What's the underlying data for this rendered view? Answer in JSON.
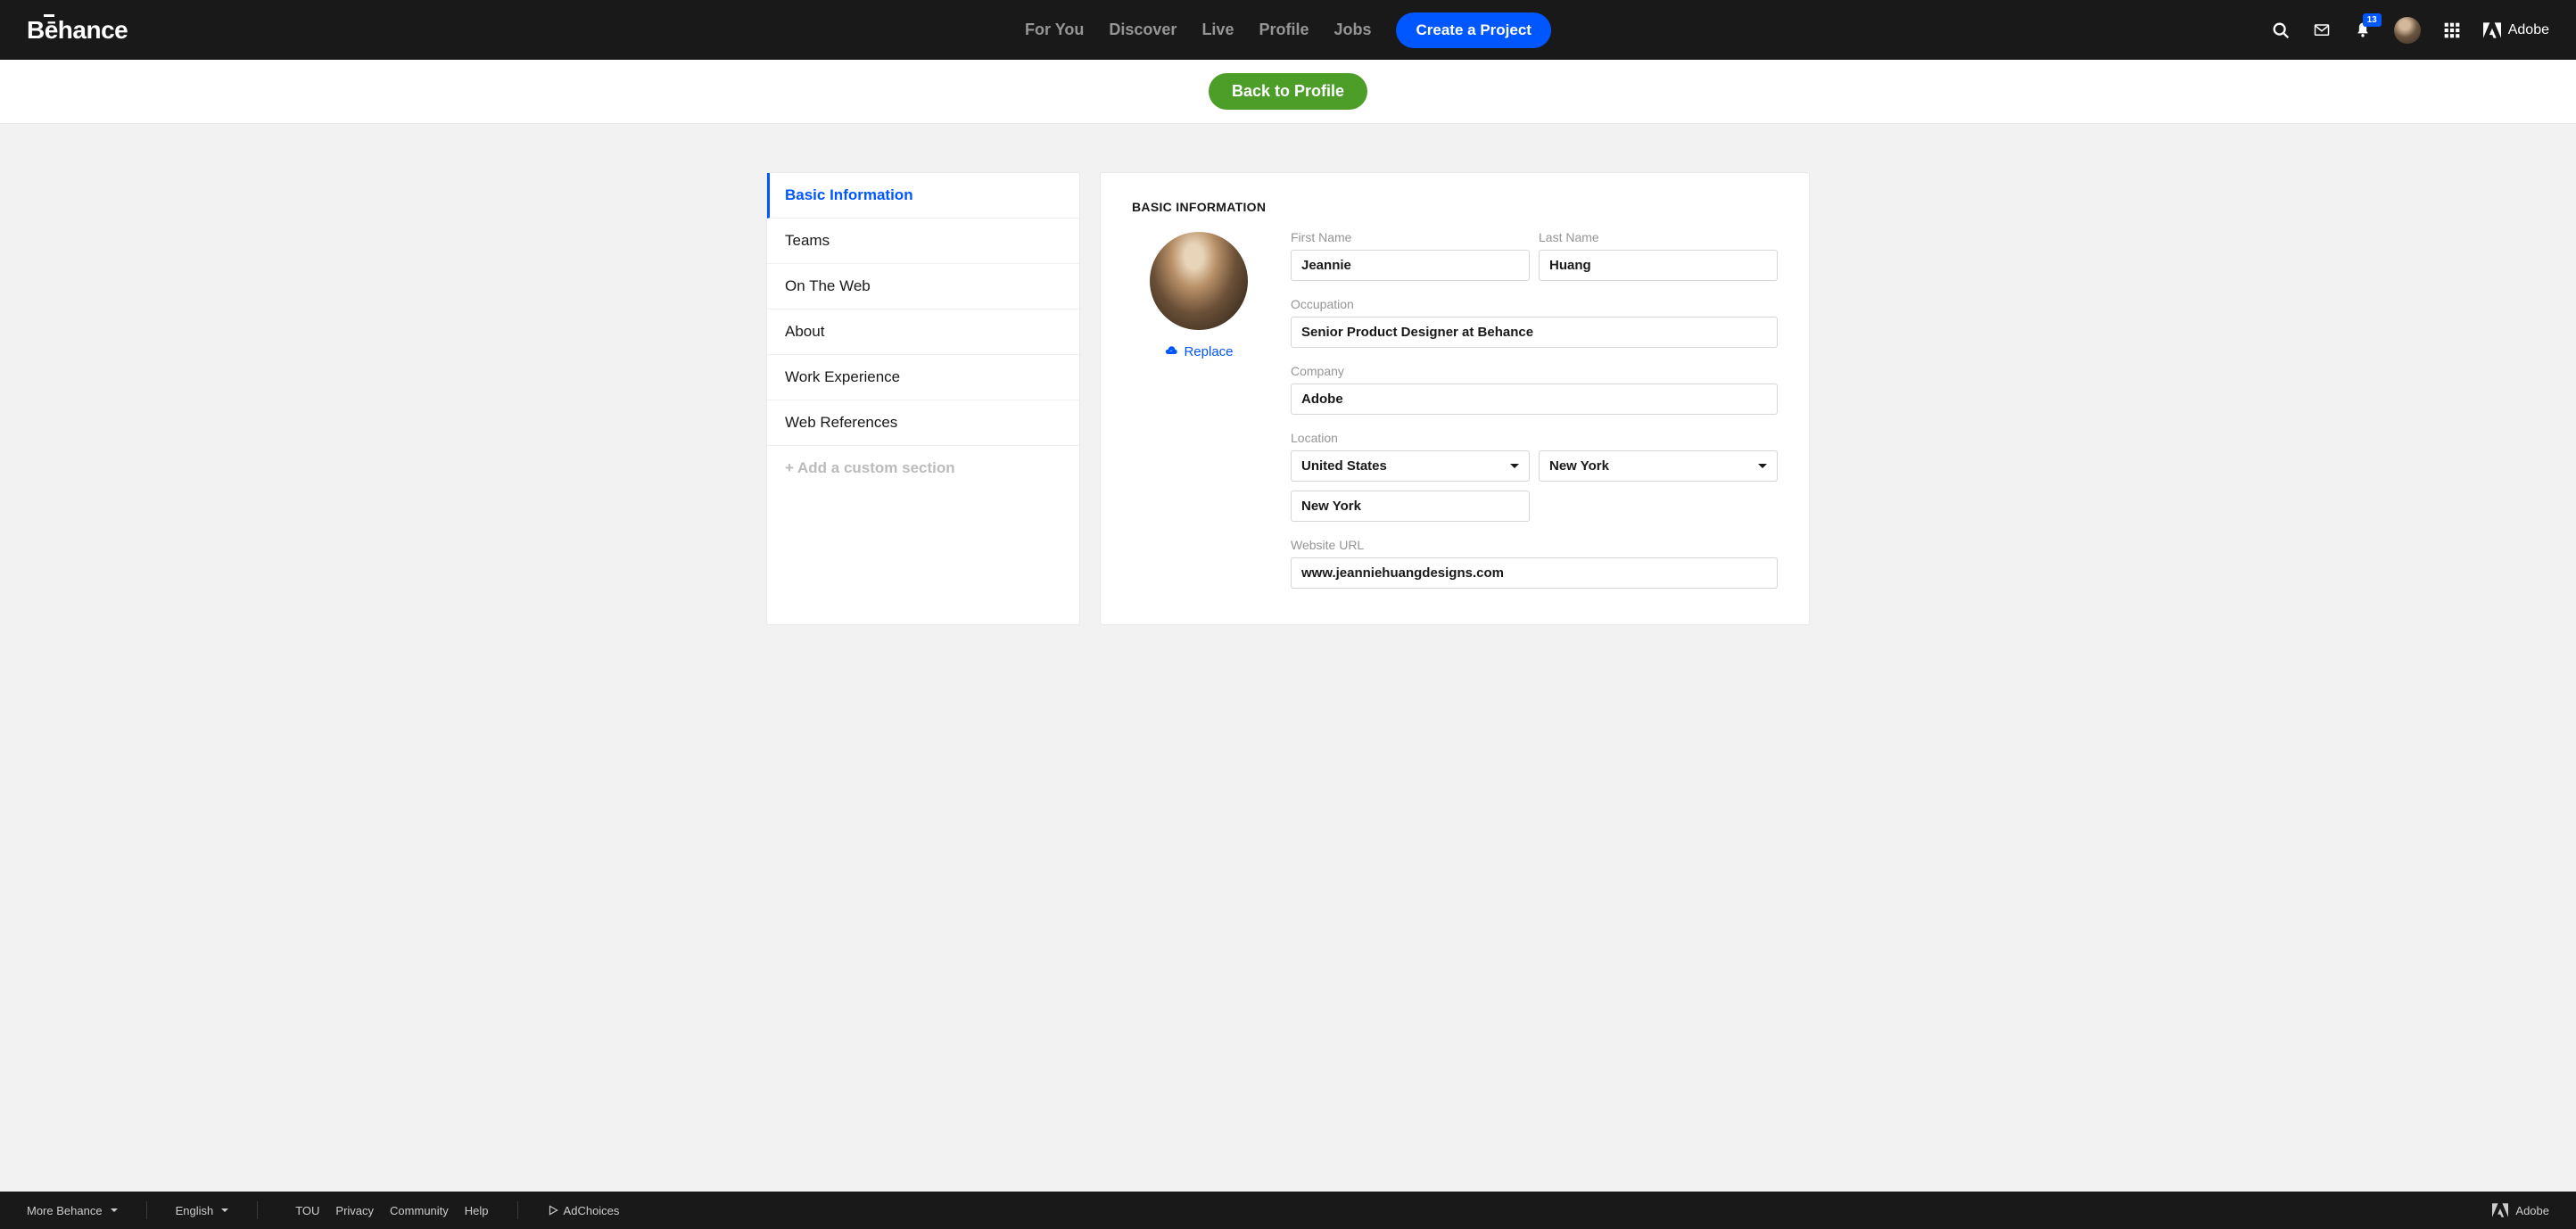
{
  "nav": {
    "logo": "Bēhance",
    "links": [
      "For You",
      "Discover",
      "Live",
      "Profile",
      "Jobs"
    ],
    "create": "Create a Project",
    "badge": "13",
    "adobe": "Adobe"
  },
  "subbar": {
    "back": "Back to Profile"
  },
  "sidebar": {
    "items": [
      "Basic Information",
      "Teams",
      "On The Web",
      "About",
      "Work Experience",
      "Web References"
    ],
    "add": "+ Add a custom section"
  },
  "form": {
    "heading": "BASIC INFORMATION",
    "replace": "Replace",
    "labels": {
      "first": "First Name",
      "last": "Last Name",
      "occupation": "Occupation",
      "company": "Company",
      "location": "Location",
      "website": "Website URL"
    },
    "values": {
      "first": "Jeannie",
      "last": "Huang",
      "occupation": "Senior Product Designer at Behance",
      "company": "Adobe",
      "country": "United States",
      "state": "New York",
      "city": "New York",
      "website": "www.jeanniehuangdesigns.com"
    }
  },
  "footer": {
    "more": "More Behance",
    "lang": "English",
    "links": [
      "TOU",
      "Privacy",
      "Community",
      "Help"
    ],
    "adchoices": "AdChoices",
    "adobe": "Adobe"
  }
}
